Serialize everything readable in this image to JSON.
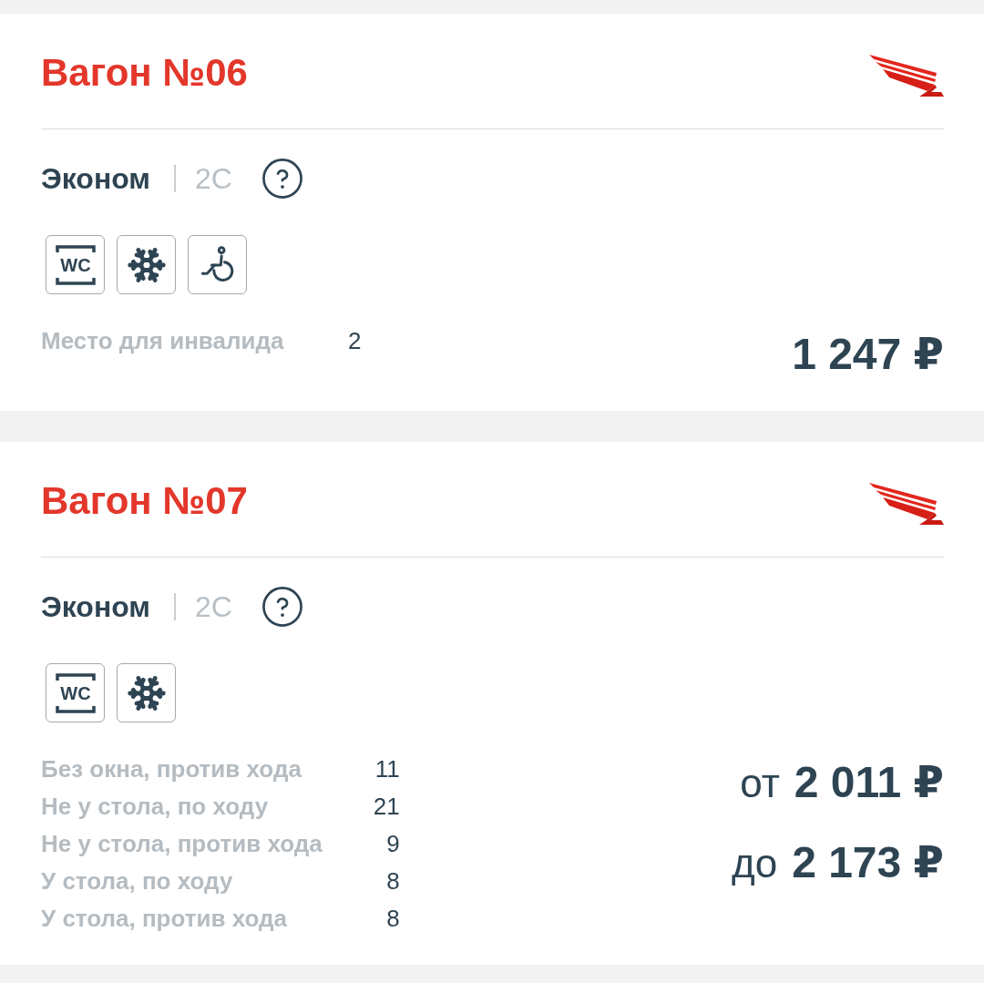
{
  "cars": [
    {
      "title": "Вагон №06",
      "class_name": "Эконом",
      "class_code": "2С",
      "amenities": [
        {
          "kind": "wc",
          "label": "WC"
        },
        {
          "kind": "snowflake"
        },
        {
          "kind": "wheelchair"
        }
      ],
      "seats": [
        {
          "label": "Место для инвалида",
          "count": "2"
        }
      ],
      "prices": [
        {
          "amount": "1 247 ₽"
        }
      ]
    },
    {
      "title": "Вагон №07",
      "class_name": "Эконом",
      "class_code": "2С",
      "amenities": [
        {
          "kind": "wc",
          "label": "WC"
        },
        {
          "kind": "snowflake"
        }
      ],
      "seats": [
        {
          "label": "Без окна, против хода",
          "count": "11"
        },
        {
          "label": "Не у стола, по ходу",
          "count": "21"
        },
        {
          "label": "Не у стола, против хода",
          "count": "9"
        },
        {
          "label": "У стола, по ходу",
          "count": "8"
        },
        {
          "label": "У стола, против хода",
          "count": "8"
        }
      ],
      "prices": [
        {
          "prefix": "от",
          "amount": "2 011 ₽"
        },
        {
          "prefix": "до",
          "amount": "2 173 ₽"
        }
      ]
    }
  ]
}
